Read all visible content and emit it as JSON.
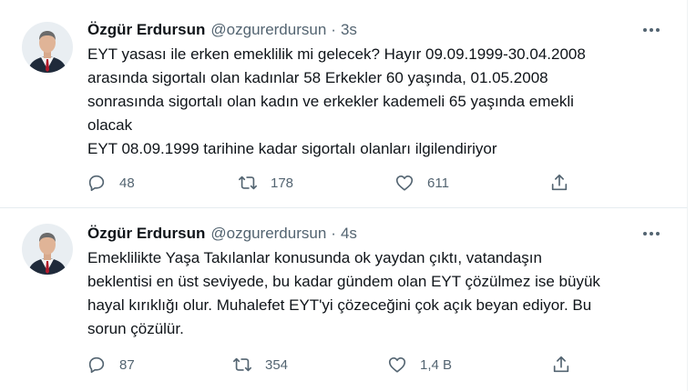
{
  "colors": {
    "text_primary": "#0f1419",
    "text_secondary": "#536471",
    "divider": "#e6ecf0"
  },
  "tweets": [
    {
      "author": {
        "name": "Özgür Erdursun",
        "handle": "@ozgurerdursun",
        "avatar_icon": "profile-photo"
      },
      "separator": "·",
      "time": "3s",
      "text_lines": [
        "EYT yasası ile erken emeklilik mi gelecek? Hayır 09.09.1999-30.04.2008",
        "arasında sigortalı olan kadınlar 58 Erkekler 60 yaşında, 01.05.2008",
        "sonrasında sigortalı olan kadın ve erkekler kademeli 65 yaşında emekli",
        "olacak",
        "EYT 08.09.1999 tarihine kadar sigortalı olanları ilgilendiriyor"
      ],
      "actions": {
        "reply": {
          "icon": "reply-icon",
          "count": "48"
        },
        "retweet": {
          "icon": "retweet-icon",
          "count": "178"
        },
        "like": {
          "icon": "heart-icon",
          "count": "611"
        },
        "share": {
          "icon": "share-icon"
        }
      },
      "more_icon": "ellipsis-icon"
    },
    {
      "author": {
        "name": "Özgür Erdursun",
        "handle": "@ozgurerdursun",
        "avatar_icon": "profile-photo"
      },
      "separator": "·",
      "time": "4s",
      "text_lines": [
        "Emeklilikte Yaşa Takılanlar konusunda ok yaydan çıktı, vatandaşın",
        "beklentisi en üst seviyede, bu kadar gündem olan EYT çözülmez ise büyük",
        "hayal kırıklığı olur. Muhalefet EYT'yi çözeceğini çok açık beyan ediyor. Bu",
        "sorun çözülür."
      ],
      "actions": {
        "reply": {
          "icon": "reply-icon",
          "count": "87"
        },
        "retweet": {
          "icon": "retweet-icon",
          "count": "354"
        },
        "like": {
          "icon": "heart-icon",
          "count": "1,4 B"
        },
        "share": {
          "icon": "share-icon"
        }
      },
      "more_icon": "ellipsis-icon"
    }
  ]
}
